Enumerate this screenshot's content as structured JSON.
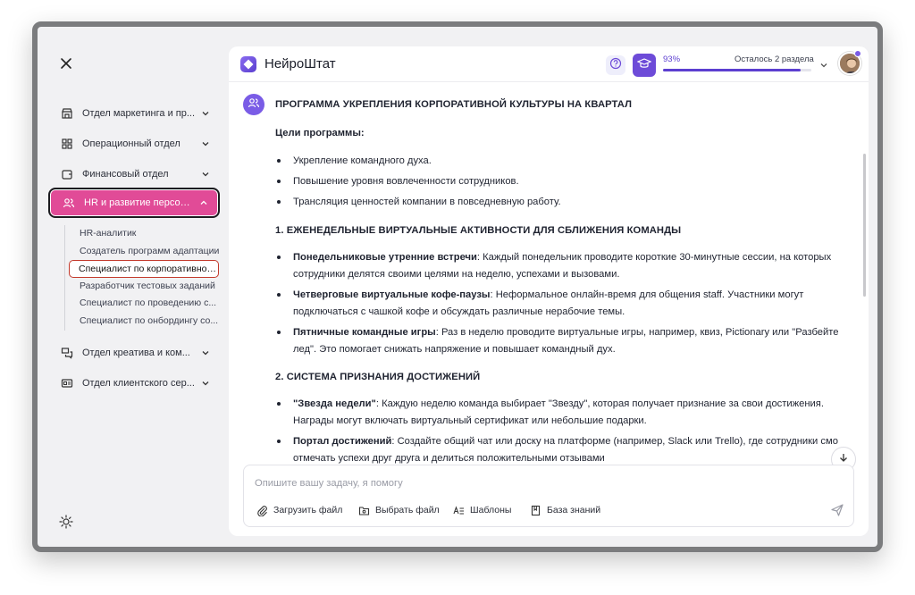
{
  "app": {
    "brand": "НейроШтат"
  },
  "sidebar": {
    "departments": [
      {
        "label": "Отдел маркетинга и пр...",
        "icon": "store-icon"
      },
      {
        "label": "Операционный отдел",
        "icon": "grid-icon"
      },
      {
        "label": "Финансовый отдел",
        "icon": "wallet-icon"
      },
      {
        "label": "HR и развитие персона...",
        "icon": "users-icon",
        "active": true
      },
      {
        "label": "Отдел креатива и ком...",
        "icon": "chat-icon"
      },
      {
        "label": "Отдел клиентского сер...",
        "icon": "id-card-icon"
      }
    ],
    "hr_subitems": [
      "HR-аналитик",
      "Создатель программ адаптации",
      "Специалист по корпоративной...",
      "Разработчик тестовых заданий",
      "Специалист по проведению с...",
      "Специалист по онбордингу со..."
    ],
    "selected_subitem_index": 2
  },
  "header": {
    "progress_percent_label": "93%",
    "progress_value": 93,
    "progress_remaining": "Осталось 2 раздела"
  },
  "message": {
    "title": "ПРОГРАММА УКРЕПЛЕНИЯ КОРПОРАТИВНОЙ КУЛЬТУРЫ НА КВАРТАЛ",
    "goals_heading": "Цели программы:",
    "goals": [
      "Укрепление командного духа.",
      "Повышение уровня вовлеченности сотрудников.",
      "Трансляция ценностей компании в повседневную работу."
    ],
    "section1": {
      "heading": "1. ЕЖЕНЕДЕЛЬНЫЕ ВИРТУАЛЬНЫЕ АКТИВНОСТИ ДЛЯ СБЛИЖЕНИЯ КОМАНДЫ",
      "items": [
        {
          "bold": "Понедельниковые утренние встречи",
          "text": ": Каждый понедельник проводите короткие 30-минутные сессии, на которых сотрудники делятся своими целями на неделю, успехами и вызовами."
        },
        {
          "bold": "Четверговые виртуальные кофе-паузы",
          "text": ": Неформальное онлайн-время для общения staff. Участники могут подключаться с чашкой кофе и обсуждать различные нерабочие темы."
        },
        {
          "bold": "Пятничные командные игры",
          "text": ": Раз в неделю проводите виртуальные игры, например, квиз, Pictionary или \"Разбейте лед\". Это помогает снижать напряжение и повышает командный дух."
        }
      ]
    },
    "section2": {
      "heading": "2. СИСТЕМА ПРИЗНАНИЯ ДОСТИЖЕНИЙ",
      "items": [
        {
          "bold": "\"Звезда недели\"",
          "text": ": Каждую неделю команда выбирает \"Звезду\", которая получает признание за свои достижения. Награды могут включать виртуальный сертификат или небольшие подарки."
        },
        {
          "bold": "Портал достижений",
          "text": ": Создайте общий чат или доску на платформе (например, Slack или Trello), где сотрудники смо отмечать успехи друг друга и делиться положительными отзывами"
        }
      ]
    }
  },
  "composer": {
    "placeholder": "Опишите вашу задачу, я помогу",
    "upload_label": "Загрузить файл",
    "choose_label": "Выбрать файл",
    "templates_label": "Шаблоны",
    "knowledge_label": "База знаний"
  },
  "colors": {
    "accent": "#6d4bd8",
    "active_pink": "#e14b97",
    "highlight_red": "#c33a2c"
  }
}
